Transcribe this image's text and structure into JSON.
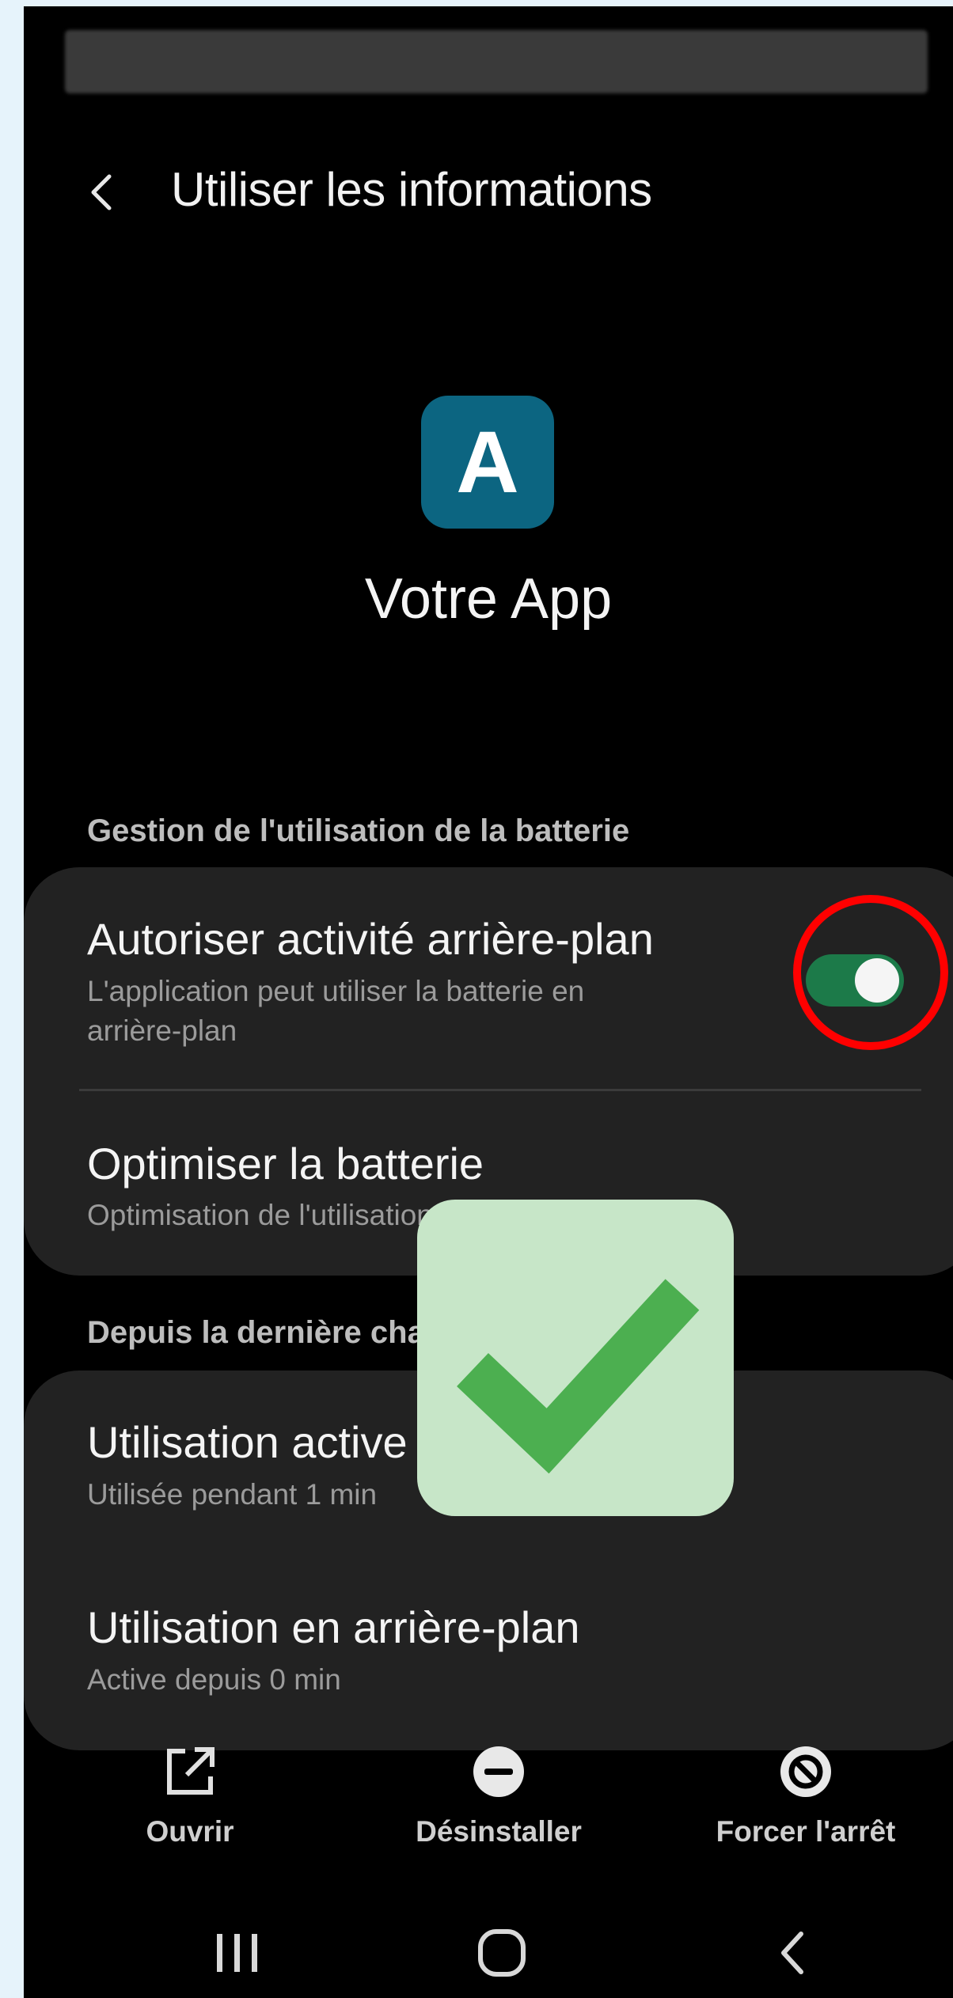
{
  "header": {
    "title": "Utiliser les informations"
  },
  "app": {
    "icon_letter": "A",
    "name": "Votre App",
    "icon_color": "#0c6581"
  },
  "battery_section": {
    "label": "Gestion de l'utilisation de la batterie",
    "background_activity": {
      "title": "Autoriser activité arrière-plan",
      "subtitle_line1": "L'application peut utiliser la batterie en",
      "subtitle_line2": "arrière-plan",
      "toggle_on": true,
      "toggle_color": "#1c7a49"
    },
    "optimize": {
      "title": "Optimiser la batterie",
      "subtitle": "Optimisation de l'utilisation de la batterie"
    }
  },
  "usage_section": {
    "label": "Depuis la dernière charge complète",
    "active_use": {
      "title": "Utilisation active",
      "subtitle": "Utilisée pendant 1 min"
    },
    "background_use": {
      "title": "Utilisation en arrière-plan",
      "subtitle": "Active depuis 0 min"
    }
  },
  "actions": {
    "open": {
      "label": "Ouvrir",
      "icon": "open-external-icon"
    },
    "uninstall": {
      "label": "Désinstaller",
      "icon": "minus-circle-icon"
    },
    "force_stop": {
      "label": "Forcer l'arrêt",
      "icon": "block-icon"
    }
  },
  "overlay": {
    "highlight_color": "#ff0000",
    "check_color": "#4caf50",
    "check_bg": "#c7e6c8"
  }
}
